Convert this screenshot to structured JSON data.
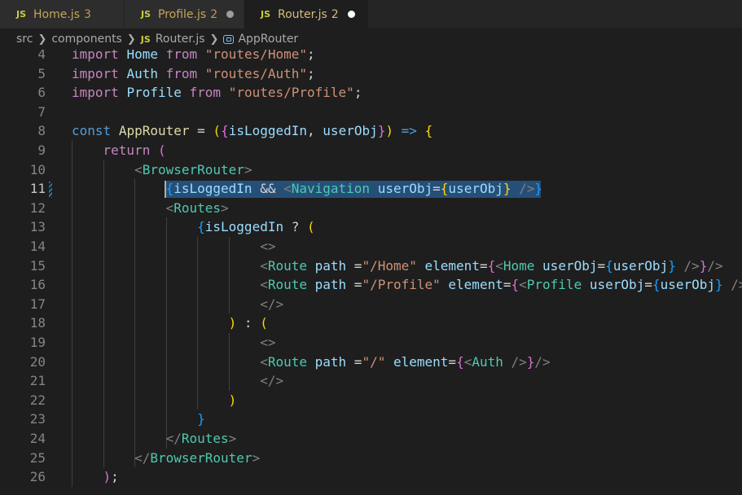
{
  "tabs": [
    {
      "icon": "JS",
      "name": "Home.js",
      "count": "3",
      "active": false
    },
    {
      "icon": "JS",
      "name": "Profile.js",
      "count": "2",
      "active": false
    },
    {
      "icon": "JS",
      "name": "Router.js",
      "count": "2",
      "active": true
    }
  ],
  "breadcrumb": {
    "part1": "src",
    "part2": "components",
    "file_icon": "JS",
    "part3": "Router.js",
    "part4": "AppRouter"
  },
  "editor": {
    "current_line": 11,
    "lines": [
      {
        "n": "4",
        "tokens": [
          [
            "t-ctl",
            "import"
          ],
          [
            "t-p",
            " "
          ],
          [
            "t-var",
            "Home"
          ],
          [
            "t-p",
            " "
          ],
          [
            "t-ctl",
            "from"
          ],
          [
            "t-p",
            " "
          ],
          [
            "t-str",
            "\"routes/Home\""
          ],
          [
            "t-p",
            ";"
          ]
        ]
      },
      {
        "n": "5",
        "tokens": [
          [
            "t-ctl",
            "import"
          ],
          [
            "t-p",
            " "
          ],
          [
            "t-var",
            "Auth"
          ],
          [
            "t-p",
            " "
          ],
          [
            "t-ctl",
            "from"
          ],
          [
            "t-p",
            " "
          ],
          [
            "t-str",
            "\"routes/Auth\""
          ],
          [
            "t-p",
            ";"
          ]
        ]
      },
      {
        "n": "6",
        "tokens": [
          [
            "t-ctl",
            "import"
          ],
          [
            "t-p",
            " "
          ],
          [
            "t-var",
            "Profile"
          ],
          [
            "t-p",
            " "
          ],
          [
            "t-ctl",
            "from"
          ],
          [
            "t-p",
            " "
          ],
          [
            "t-str",
            "\"routes/Profile\""
          ],
          [
            "t-p",
            ";"
          ]
        ]
      },
      {
        "n": "7",
        "tokens": []
      },
      {
        "n": "8",
        "tokens": [
          [
            "t-kw",
            "const"
          ],
          [
            "t-p",
            " "
          ],
          [
            "t-fn",
            "AppRouter"
          ],
          [
            "t-p",
            " = "
          ],
          [
            "t-b1",
            "("
          ],
          [
            "t-b2",
            "{"
          ],
          [
            "t-var",
            "isLoggedIn"
          ],
          [
            "t-p",
            ", "
          ],
          [
            "t-var",
            "userObj"
          ],
          [
            "t-b2",
            "}"
          ],
          [
            "t-b1",
            ")"
          ],
          [
            "t-p",
            " "
          ],
          [
            "t-kw",
            "=>"
          ],
          [
            "t-p",
            " "
          ],
          [
            "t-b1",
            "{"
          ]
        ]
      },
      {
        "n": "9",
        "tokens": [
          [
            "t-p",
            "    "
          ],
          [
            "t-ctl",
            "return"
          ],
          [
            "t-p",
            " "
          ],
          [
            "t-b2",
            "("
          ]
        ]
      },
      {
        "n": "10",
        "tokens": [
          [
            "t-p",
            "        "
          ],
          [
            "t-ang",
            "<"
          ],
          [
            "t-tag",
            "BrowserRouter"
          ],
          [
            "t-ang",
            ">"
          ]
        ]
      },
      {
        "n": "11",
        "tokens": [
          [
            "t-p",
            "            "
          ],
          [
            "t-b3",
            "{"
          ],
          [
            "t-var",
            "isLoggedIn"
          ],
          [
            "t-p",
            " && "
          ],
          [
            "t-ang",
            "<"
          ],
          [
            "t-tag",
            "Navigation"
          ],
          [
            "t-p",
            " "
          ],
          [
            "t-var",
            "userObj"
          ],
          [
            "t-p",
            "="
          ],
          [
            "t-b1",
            "{"
          ],
          [
            "t-var",
            "userObj"
          ],
          [
            "t-b1",
            "}"
          ],
          [
            "t-p",
            " "
          ],
          [
            "t-ang",
            "/>"
          ],
          [
            "t-b3",
            "}"
          ]
        ]
      },
      {
        "n": "12",
        "tokens": [
          [
            "t-p",
            "            "
          ],
          [
            "t-ang",
            "<"
          ],
          [
            "t-tag",
            "Routes"
          ],
          [
            "t-ang",
            ">"
          ]
        ]
      },
      {
        "n": "13",
        "tokens": [
          [
            "t-p",
            "                "
          ],
          [
            "t-b3",
            "{"
          ],
          [
            "t-var",
            "isLoggedIn"
          ],
          [
            "t-p",
            " ? "
          ],
          [
            "t-b1",
            "("
          ]
        ]
      },
      {
        "n": "14",
        "tokens": [
          [
            "t-p",
            "                        "
          ],
          [
            "t-ang",
            "<>"
          ]
        ]
      },
      {
        "n": "15",
        "tokens": [
          [
            "t-p",
            "                        "
          ],
          [
            "t-ang",
            "<"
          ],
          [
            "t-tag",
            "Route"
          ],
          [
            "t-p",
            " "
          ],
          [
            "t-var",
            "path"
          ],
          [
            "t-p",
            " ="
          ],
          [
            "t-str",
            "\"/Home\""
          ],
          [
            "t-p",
            " "
          ],
          [
            "t-var",
            "element"
          ],
          [
            "t-p",
            "="
          ],
          [
            "t-b2",
            "{"
          ],
          [
            "t-ang",
            "<"
          ],
          [
            "t-tag",
            "Home"
          ],
          [
            "t-p",
            " "
          ],
          [
            "t-var",
            "userObj"
          ],
          [
            "t-p",
            "="
          ],
          [
            "t-b3",
            "{"
          ],
          [
            "t-var",
            "userObj"
          ],
          [
            "t-b3",
            "}"
          ],
          [
            "t-p",
            " "
          ],
          [
            "t-ang",
            "/>"
          ],
          [
            "t-b2",
            "}"
          ],
          [
            "t-ang",
            "/>"
          ]
        ]
      },
      {
        "n": "16",
        "tokens": [
          [
            "t-p",
            "                        "
          ],
          [
            "t-ang",
            "<"
          ],
          [
            "t-tag",
            "Route"
          ],
          [
            "t-p",
            " "
          ],
          [
            "t-var",
            "path"
          ],
          [
            "t-p",
            " ="
          ],
          [
            "t-str",
            "\"/Profile\""
          ],
          [
            "t-p",
            " "
          ],
          [
            "t-var",
            "element"
          ],
          [
            "t-p",
            "="
          ],
          [
            "t-b2",
            "{"
          ],
          [
            "t-ang",
            "<"
          ],
          [
            "t-tag",
            "Profile"
          ],
          [
            "t-p",
            " "
          ],
          [
            "t-var",
            "userObj"
          ],
          [
            "t-p",
            "="
          ],
          [
            "t-b3",
            "{"
          ],
          [
            "t-var",
            "userObj"
          ],
          [
            "t-b3",
            "}"
          ],
          [
            "t-p",
            " "
          ],
          [
            "t-ang",
            "/>"
          ]
        ]
      },
      {
        "n": "17",
        "tokens": [
          [
            "t-p",
            "                        "
          ],
          [
            "t-ang",
            "</>"
          ]
        ]
      },
      {
        "n": "18",
        "tokens": [
          [
            "t-p",
            "                    "
          ],
          [
            "t-b1",
            ")"
          ],
          [
            "t-p",
            " : "
          ],
          [
            "t-b1",
            "("
          ]
        ]
      },
      {
        "n": "19",
        "tokens": [
          [
            "t-p",
            "                        "
          ],
          [
            "t-ang",
            "<>"
          ]
        ]
      },
      {
        "n": "20",
        "tokens": [
          [
            "t-p",
            "                        "
          ],
          [
            "t-ang",
            "<"
          ],
          [
            "t-tag",
            "Route"
          ],
          [
            "t-p",
            " "
          ],
          [
            "t-var",
            "path"
          ],
          [
            "t-p",
            " ="
          ],
          [
            "t-str",
            "\"/\""
          ],
          [
            "t-p",
            " "
          ],
          [
            "t-var",
            "element"
          ],
          [
            "t-p",
            "="
          ],
          [
            "t-b2",
            "{"
          ],
          [
            "t-ang",
            "<"
          ],
          [
            "t-tag",
            "Auth"
          ],
          [
            "t-p",
            " "
          ],
          [
            "t-ang",
            "/>"
          ],
          [
            "t-b2",
            "}"
          ],
          [
            "t-ang",
            "/>"
          ]
        ]
      },
      {
        "n": "21",
        "tokens": [
          [
            "t-p",
            "                        "
          ],
          [
            "t-ang",
            "</>"
          ]
        ]
      },
      {
        "n": "22",
        "tokens": [
          [
            "t-p",
            "                    "
          ],
          [
            "t-b1",
            ")"
          ]
        ]
      },
      {
        "n": "23",
        "tokens": [
          [
            "t-p",
            "                "
          ],
          [
            "t-b3",
            "}"
          ]
        ]
      },
      {
        "n": "24",
        "tokens": [
          [
            "t-p",
            "            "
          ],
          [
            "t-ang",
            "</"
          ],
          [
            "t-tag",
            "Routes"
          ],
          [
            "t-ang",
            ">"
          ]
        ]
      },
      {
        "n": "25",
        "tokens": [
          [
            "t-p",
            "        "
          ],
          [
            "t-ang",
            "</"
          ],
          [
            "t-tag",
            "BrowserRouter"
          ],
          [
            "t-ang",
            ">"
          ]
        ]
      },
      {
        "n": "26",
        "tokens": [
          [
            "t-p",
            "    "
          ],
          [
            "t-b2",
            ")"
          ],
          [
            "t-p",
            ";"
          ]
        ]
      }
    ]
  },
  "colors": {
    "editor_bg": "#1e1e1e",
    "selection": "#264f78",
    "keyword": "#569cd6",
    "control": "#c586c0",
    "variable": "#9cdcfe",
    "string": "#ce9178",
    "tag": "#4ec9b0"
  }
}
